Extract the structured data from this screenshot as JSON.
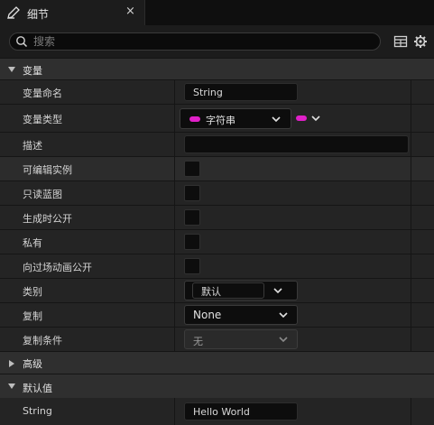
{
  "tab": {
    "title": "细节",
    "close": "×",
    "icon": "edit-icon"
  },
  "toolbar": {
    "search_placeholder": "搜索",
    "icons": [
      "grid-icon",
      "gear-icon"
    ]
  },
  "sections": {
    "variables": "变量",
    "advanced": "高级",
    "default_value": "默认值"
  },
  "fields": {
    "name": {
      "label": "变量命名",
      "value": "String"
    },
    "type": {
      "label": "变量类型",
      "value": "字符串",
      "pin_color": "#e020c8"
    },
    "description": {
      "label": "描述",
      "value": ""
    },
    "editable": {
      "label": "可编辑实例"
    },
    "readonly": {
      "label": "只读蓝图"
    },
    "expose_on_spawn": {
      "label": "生成时公开"
    },
    "private": {
      "label": "私有"
    },
    "expose_to_cinematics": {
      "label": "向过场动画公开"
    },
    "category": {
      "label": "类别",
      "value": "默认"
    },
    "replication": {
      "label": "复制",
      "value": "None"
    },
    "replication_condition": {
      "label": "复制条件",
      "value": "无"
    },
    "default_string": {
      "label": "String",
      "value": "Hello World"
    }
  },
  "colors": {
    "accent_pin": "#e020c8",
    "panel": "#242424",
    "header": "#2f2f2f"
  }
}
